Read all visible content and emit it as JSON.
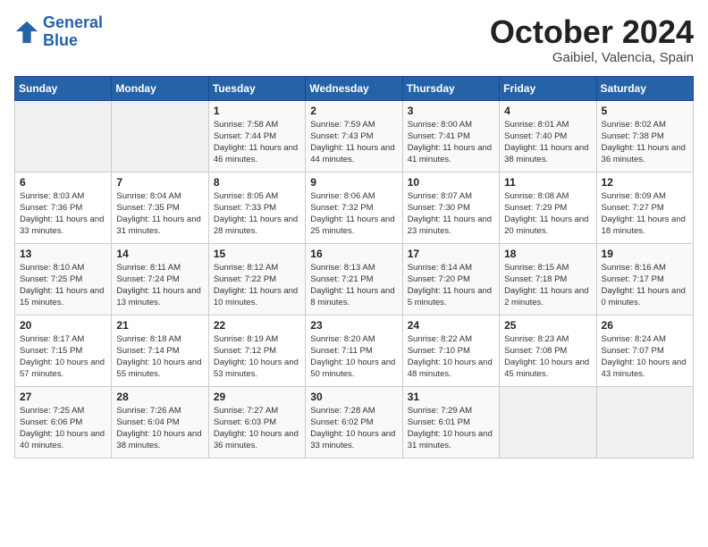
{
  "header": {
    "logo": {
      "line1": "General",
      "line2": "Blue"
    },
    "title": "October 2024",
    "subtitle": "Gaibiel, Valencia, Spain"
  },
  "weekdays": [
    "Sunday",
    "Monday",
    "Tuesday",
    "Wednesday",
    "Thursday",
    "Friday",
    "Saturday"
  ],
  "weeks": [
    [
      {
        "day": "",
        "info": ""
      },
      {
        "day": "",
        "info": ""
      },
      {
        "day": "1",
        "info": "Sunrise: 7:58 AM\nSunset: 7:44 PM\nDaylight: 11 hours and 46 minutes."
      },
      {
        "day": "2",
        "info": "Sunrise: 7:59 AM\nSunset: 7:43 PM\nDaylight: 11 hours and 44 minutes."
      },
      {
        "day": "3",
        "info": "Sunrise: 8:00 AM\nSunset: 7:41 PM\nDaylight: 11 hours and 41 minutes."
      },
      {
        "day": "4",
        "info": "Sunrise: 8:01 AM\nSunset: 7:40 PM\nDaylight: 11 hours and 38 minutes."
      },
      {
        "day": "5",
        "info": "Sunrise: 8:02 AM\nSunset: 7:38 PM\nDaylight: 11 hours and 36 minutes."
      }
    ],
    [
      {
        "day": "6",
        "info": "Sunrise: 8:03 AM\nSunset: 7:36 PM\nDaylight: 11 hours and 33 minutes."
      },
      {
        "day": "7",
        "info": "Sunrise: 8:04 AM\nSunset: 7:35 PM\nDaylight: 11 hours and 31 minutes."
      },
      {
        "day": "8",
        "info": "Sunrise: 8:05 AM\nSunset: 7:33 PM\nDaylight: 11 hours and 28 minutes."
      },
      {
        "day": "9",
        "info": "Sunrise: 8:06 AM\nSunset: 7:32 PM\nDaylight: 11 hours and 25 minutes."
      },
      {
        "day": "10",
        "info": "Sunrise: 8:07 AM\nSunset: 7:30 PM\nDaylight: 11 hours and 23 minutes."
      },
      {
        "day": "11",
        "info": "Sunrise: 8:08 AM\nSunset: 7:29 PM\nDaylight: 11 hours and 20 minutes."
      },
      {
        "day": "12",
        "info": "Sunrise: 8:09 AM\nSunset: 7:27 PM\nDaylight: 11 hours and 18 minutes."
      }
    ],
    [
      {
        "day": "13",
        "info": "Sunrise: 8:10 AM\nSunset: 7:25 PM\nDaylight: 11 hours and 15 minutes."
      },
      {
        "day": "14",
        "info": "Sunrise: 8:11 AM\nSunset: 7:24 PM\nDaylight: 11 hours and 13 minutes."
      },
      {
        "day": "15",
        "info": "Sunrise: 8:12 AM\nSunset: 7:22 PM\nDaylight: 11 hours and 10 minutes."
      },
      {
        "day": "16",
        "info": "Sunrise: 8:13 AM\nSunset: 7:21 PM\nDaylight: 11 hours and 8 minutes."
      },
      {
        "day": "17",
        "info": "Sunrise: 8:14 AM\nSunset: 7:20 PM\nDaylight: 11 hours and 5 minutes."
      },
      {
        "day": "18",
        "info": "Sunrise: 8:15 AM\nSunset: 7:18 PM\nDaylight: 11 hours and 2 minutes."
      },
      {
        "day": "19",
        "info": "Sunrise: 8:16 AM\nSunset: 7:17 PM\nDaylight: 11 hours and 0 minutes."
      }
    ],
    [
      {
        "day": "20",
        "info": "Sunrise: 8:17 AM\nSunset: 7:15 PM\nDaylight: 10 hours and 57 minutes."
      },
      {
        "day": "21",
        "info": "Sunrise: 8:18 AM\nSunset: 7:14 PM\nDaylight: 10 hours and 55 minutes."
      },
      {
        "day": "22",
        "info": "Sunrise: 8:19 AM\nSunset: 7:12 PM\nDaylight: 10 hours and 53 minutes."
      },
      {
        "day": "23",
        "info": "Sunrise: 8:20 AM\nSunset: 7:11 PM\nDaylight: 10 hours and 50 minutes."
      },
      {
        "day": "24",
        "info": "Sunrise: 8:22 AM\nSunset: 7:10 PM\nDaylight: 10 hours and 48 minutes."
      },
      {
        "day": "25",
        "info": "Sunrise: 8:23 AM\nSunset: 7:08 PM\nDaylight: 10 hours and 45 minutes."
      },
      {
        "day": "26",
        "info": "Sunrise: 8:24 AM\nSunset: 7:07 PM\nDaylight: 10 hours and 43 minutes."
      }
    ],
    [
      {
        "day": "27",
        "info": "Sunrise: 7:25 AM\nSunset: 6:06 PM\nDaylight: 10 hours and 40 minutes."
      },
      {
        "day": "28",
        "info": "Sunrise: 7:26 AM\nSunset: 6:04 PM\nDaylight: 10 hours and 38 minutes."
      },
      {
        "day": "29",
        "info": "Sunrise: 7:27 AM\nSunset: 6:03 PM\nDaylight: 10 hours and 36 minutes."
      },
      {
        "day": "30",
        "info": "Sunrise: 7:28 AM\nSunset: 6:02 PM\nDaylight: 10 hours and 33 minutes."
      },
      {
        "day": "31",
        "info": "Sunrise: 7:29 AM\nSunset: 6:01 PM\nDaylight: 10 hours and 31 minutes."
      },
      {
        "day": "",
        "info": ""
      },
      {
        "day": "",
        "info": ""
      }
    ]
  ]
}
